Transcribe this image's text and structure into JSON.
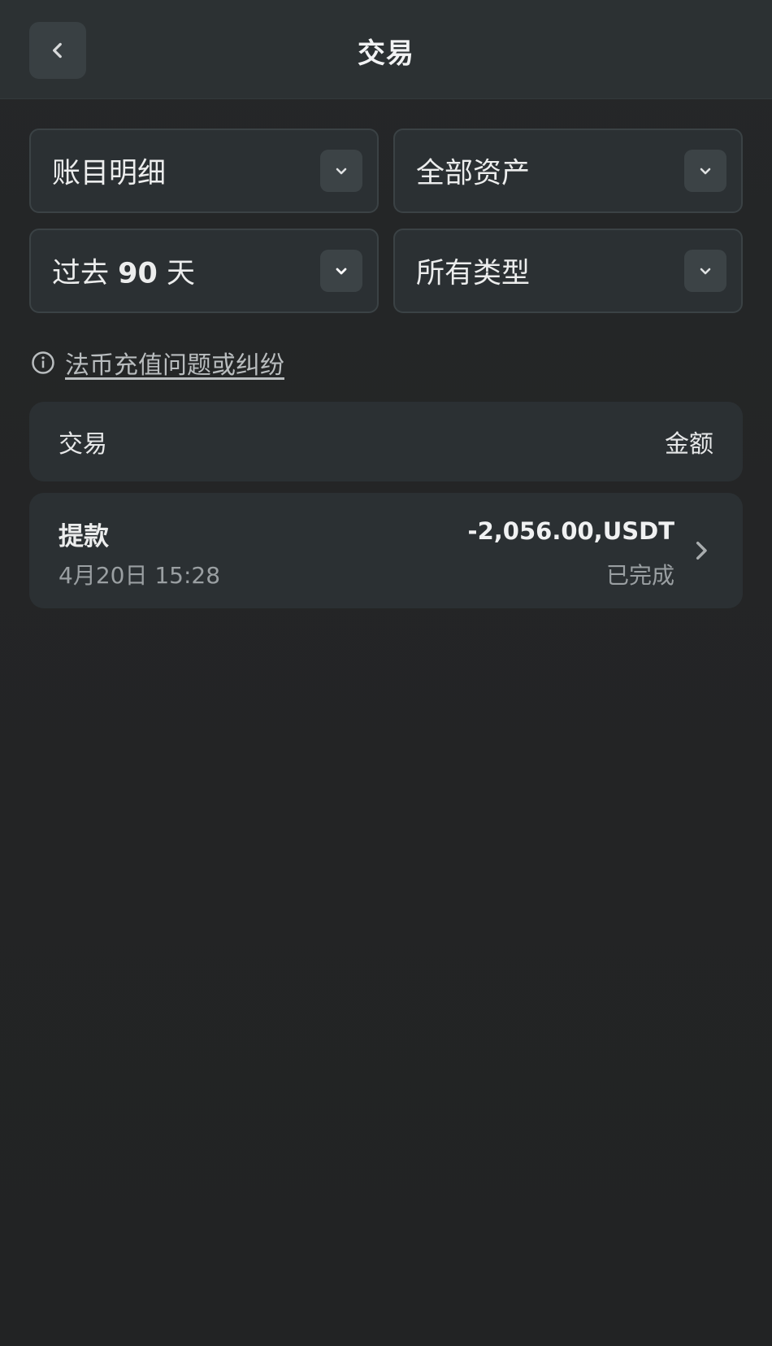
{
  "header": {
    "title": "交易"
  },
  "filters": {
    "statement": "账目明细",
    "asset": "全部资产",
    "period_prefix": "过去",
    "period_number": "90",
    "period_suffix": "天",
    "type": "所有类型"
  },
  "info_link": {
    "text": "法币充值问题或纠纷"
  },
  "table": {
    "col_transaction": "交易",
    "col_amount": "金额",
    "rows": [
      {
        "type": "提款",
        "time": "4月20日 15:28",
        "amount": "-2,056.00,USDT",
        "status": "已完成"
      }
    ]
  },
  "colors": {
    "background": "#232425",
    "card": "#2b3033",
    "header": "#2c3133",
    "text_primary": "#eceded",
    "text_secondary": "#9a9fa2"
  },
  "icons": {
    "back": "chevron-left-icon",
    "dropdown": "chevron-down-icon",
    "info": "info-circle-icon",
    "row_arrow": "chevron-right-icon"
  }
}
